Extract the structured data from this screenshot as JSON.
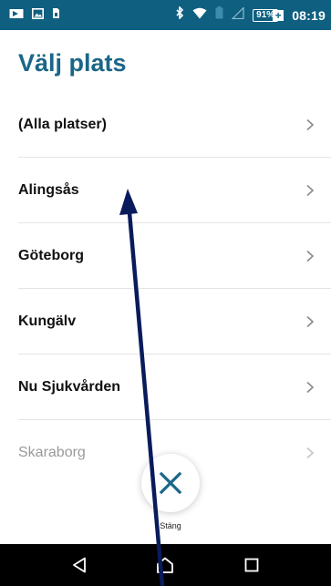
{
  "status_bar": {
    "battery_percent": "91%",
    "battery_plus": "+",
    "time": "08:19",
    "background": "#0e5f80"
  },
  "page": {
    "title": "Välj plats"
  },
  "locations": [
    {
      "label": "(Alla platser)"
    },
    {
      "label": "Alingsås"
    },
    {
      "label": "Göteborg"
    },
    {
      "label": "Kungälv"
    },
    {
      "label": "Nu Sjukvården"
    },
    {
      "label": "Skaraborg"
    }
  ],
  "close": {
    "label": "Stäng",
    "accent": "#1a6688"
  },
  "nav": {
    "back_icon": "back-triangle-icon",
    "home_icon": "home-icon",
    "recents_icon": "recents-square-icon"
  }
}
